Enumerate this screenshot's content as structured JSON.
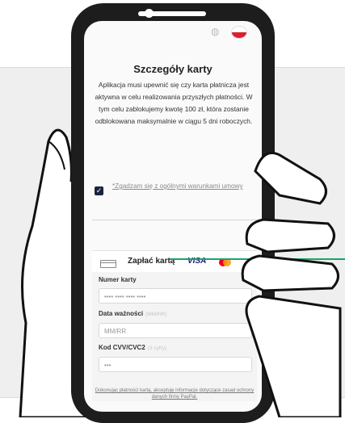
{
  "screen": {
    "title": "Szczegóły karty",
    "description": "Aplikacja musi upewnić się czy karta płatnicza jest aktywna w celu realizowania przyszłych płatności. W tym celu zablokujemy kwotę 100 zł, która zostanie odblokowana maksymalnie w ciągu 5 dni roboczych.",
    "consent_label": "*Zgadzam się z ogólnymi warunkami umowy",
    "checkbox_checked": true
  },
  "card_form": {
    "header_label": "Zapłać kartą",
    "visa_label": "VISA",
    "card_number_label": "Numer karty",
    "card_number_placeholder": "•••• •••• •••• ••••",
    "expiry_label": "Data ważności",
    "expiry_hint": "(MM/RR)",
    "expiry_placeholder": "MM/RR",
    "cvv_label": "Kod CVV/CVC2",
    "cvv_hint": "(3 cyfry)",
    "cvv_placeholder": "•••",
    "footer_note": "Dokonując płatności kartą, akceptuję informacje dotyczące zasad ochrony danych firmy PayPal."
  },
  "colors": {
    "accent_line": "#1aa36a",
    "checkbox": "#1c2340",
    "phone_frame": "#1d1d1d"
  }
}
